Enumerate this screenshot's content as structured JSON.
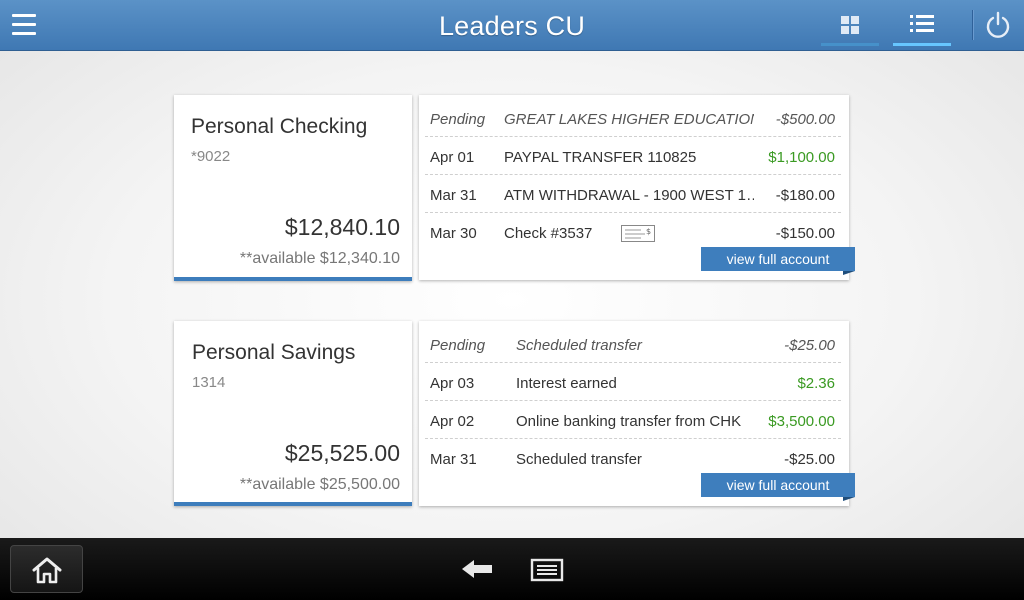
{
  "header": {
    "title": "Leaders CU",
    "icons": {
      "menu": "hamburger-menu-icon",
      "grid": "grid-view-icon",
      "list": "list-view-icon",
      "power": "power-icon"
    },
    "accent_color": "#4a84bf"
  },
  "accounts": [
    {
      "name": "Personal Checking",
      "number": "*9022",
      "balance": "$12,840.10",
      "available": "**available $12,340.10",
      "transactions": [
        {
          "date": "Pending",
          "description": "GREAT LAKES HIGHER EDUCATION…",
          "amount": "-$500.00"
        },
        {
          "date": "Apr 01",
          "description": "PAYPAL TRANSFER 110825",
          "amount": "$1,100.00"
        },
        {
          "date": "Mar 31",
          "description": "ATM WITHDRAWAL - 1900 WEST 1…",
          "amount": "-$180.00"
        },
        {
          "date": "Mar 30",
          "description": "Check #3537",
          "amount": "-$150.00",
          "icon": "check-image-icon"
        }
      ],
      "view_full_label": "view full account"
    },
    {
      "name": "Personal Savings",
      "number": "1314",
      "balance": "$25,525.00",
      "available": "**available $25,500.00",
      "transactions": [
        {
          "date": "Pending",
          "description": "Scheduled transfer",
          "amount": "-$25.00"
        },
        {
          "date": "Apr 03",
          "description": "Interest earned",
          "amount": "$2.36"
        },
        {
          "date": "Apr 02",
          "description": "Online banking transfer from CHK",
          "amount": "$3,500.00"
        },
        {
          "date": "Mar 31",
          "description": "Scheduled transfer",
          "amount": "-$25.00"
        }
      ],
      "view_full_label": "view full account"
    }
  ],
  "navbar": {
    "icons": {
      "home": "home-icon",
      "back": "back-arrow-icon",
      "recent": "recent-apps-icon"
    }
  },
  "colors": {
    "positive": "#3a9a22",
    "header": "#4a84bf",
    "button": "#3e7ebd"
  }
}
